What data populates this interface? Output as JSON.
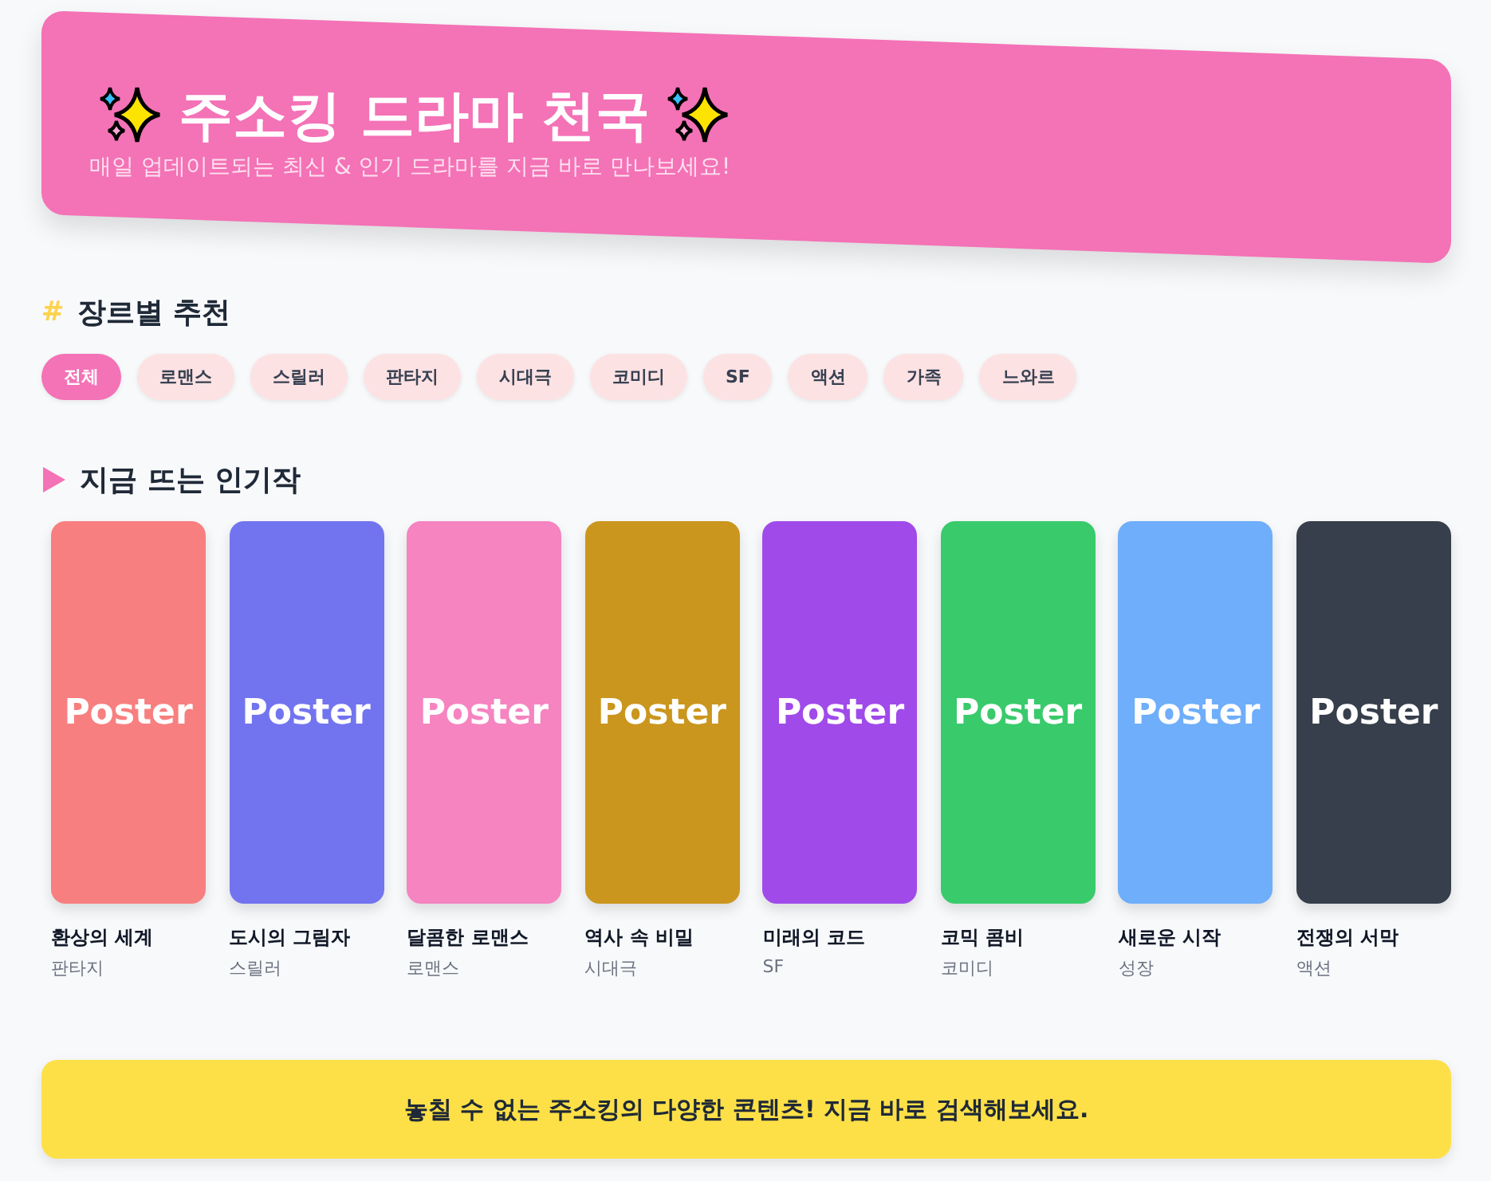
{
  "header": {
    "title": "주소킹 드라마 천국",
    "subtitle": "매일 업데이트되는 최신 & 인기 드라마를 지금 바로 만나보세요!"
  },
  "genres": {
    "mark": "#",
    "title": "장르별 추천",
    "chips": [
      {
        "label": "전체",
        "selected": true
      },
      {
        "label": "로맨스",
        "selected": false
      },
      {
        "label": "스릴러",
        "selected": false
      },
      {
        "label": "판타지",
        "selected": false
      },
      {
        "label": "시대극",
        "selected": false
      },
      {
        "label": "코미디",
        "selected": false
      },
      {
        "label": "SF",
        "selected": false
      },
      {
        "label": "액션",
        "selected": false
      },
      {
        "label": "가족",
        "selected": false
      },
      {
        "label": "느와르",
        "selected": false
      }
    ]
  },
  "popular": {
    "title": "지금 뜨는 인기작",
    "items": [
      {
        "poster": "Poster",
        "title": "환상의 세계",
        "genre": "판타지",
        "color": "#f87f7f"
      },
      {
        "poster": "Poster",
        "title": "도시의 그림자",
        "genre": "스릴러",
        "color": "#7274ef"
      },
      {
        "poster": "Poster",
        "title": "달콤한 로맨스",
        "genre": "로맨스",
        "color": "#f584c0"
      },
      {
        "poster": "Poster",
        "title": "역사 속 비밀",
        "genre": "시대극",
        "color": "#ca961d"
      },
      {
        "poster": "Poster",
        "title": "미래의 코드",
        "genre": "SF",
        "color": "#a04aea"
      },
      {
        "poster": "Poster",
        "title": "코믹 콤비",
        "genre": "코미디",
        "color": "#39ca6c"
      },
      {
        "poster": "Poster",
        "title": "새로운 시작",
        "genre": "성장",
        "color": "#6eaefa"
      },
      {
        "poster": "Poster",
        "title": "전쟁의 서막",
        "genre": "액션",
        "color": "#363f4b"
      }
    ]
  },
  "footer_banner": "놓칠 수 없는 주소킹의 다양한 콘텐츠! 지금 바로 검색해보세요."
}
